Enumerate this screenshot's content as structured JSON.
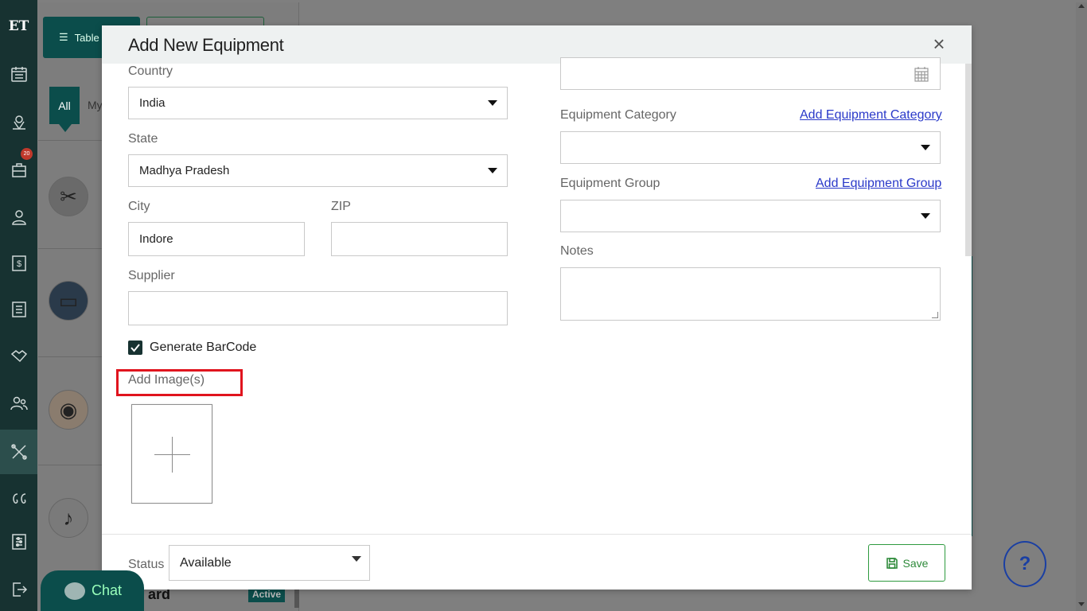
{
  "app": {
    "logo_text": "ET",
    "badge_count": "20"
  },
  "background": {
    "table_button": "Table",
    "tab_all": "All",
    "tab_my": "My",
    "partial_name": "ard",
    "status_badge": "Active",
    "chat_label": "Chat",
    "help_label": "?"
  },
  "modal": {
    "title": "Add New Equipment",
    "close_label": "×",
    "left": {
      "country_label": "Country",
      "country_value": "India",
      "state_label": "State",
      "state_value": "Madhya Pradesh",
      "city_label": "City",
      "city_value": "Indore",
      "zip_label": "ZIP",
      "zip_value": "",
      "supplier_label": "Supplier",
      "supplier_value": "",
      "barcode_label": "Generate BarCode",
      "barcode_checked": true,
      "add_images_label": "Add Image(s)"
    },
    "right": {
      "date_value": "",
      "category_label": "Equipment Category",
      "category_link": "Add Equipment Category",
      "category_value": "",
      "group_label": "Equipment Group",
      "group_link": "Add Equipment Group",
      "group_value": "",
      "notes_label": "Notes",
      "notes_value": ""
    },
    "footer": {
      "status_label": "Status",
      "status_value": "Available",
      "save_label": "Save"
    }
  },
  "colors": {
    "sidebar": "#173231",
    "accent": "#0b4d4b",
    "link": "#2a39c9",
    "save": "#2e8a3a",
    "highlight": "#e0141e"
  }
}
